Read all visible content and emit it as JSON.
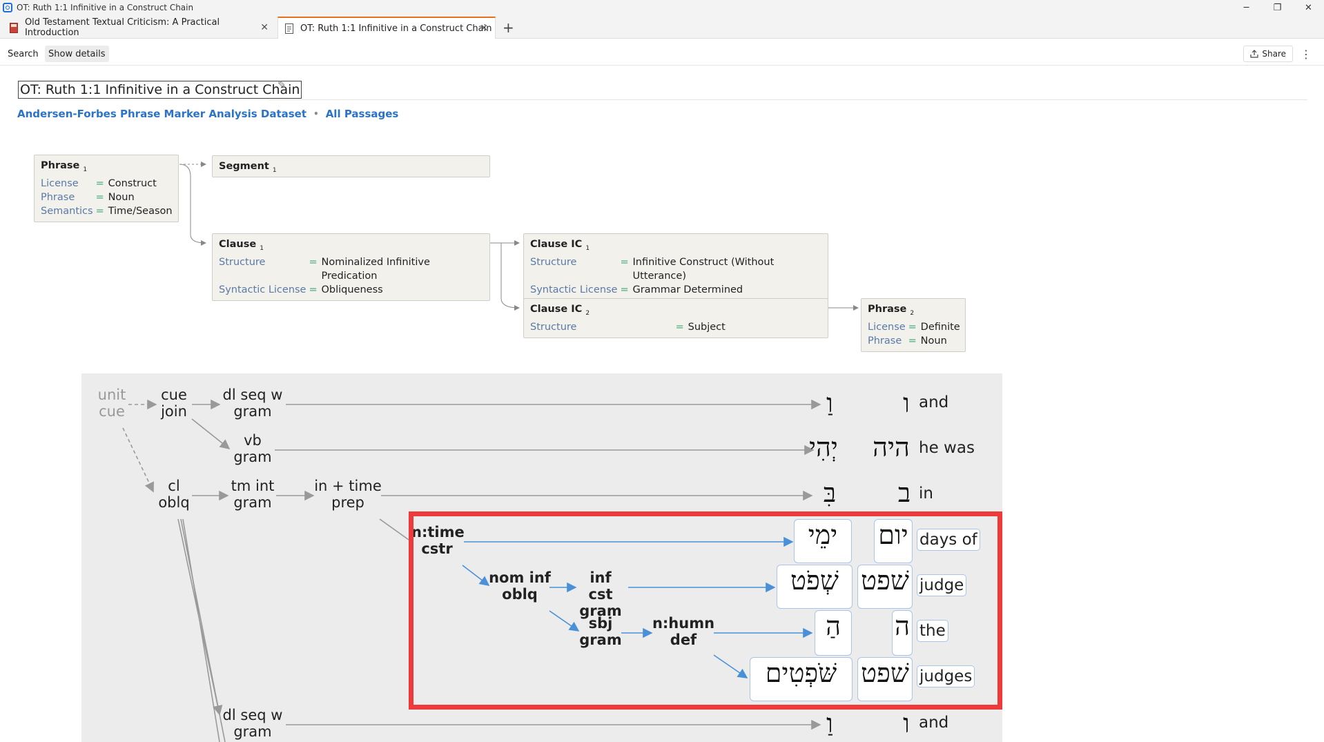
{
  "window": {
    "title": "OT: Ruth 1:1 Infinitive in a Construct Chain",
    "controls": {
      "minimize": "─",
      "restore": "❐",
      "close": "✕"
    }
  },
  "tabs": [
    {
      "label": "Old Testament Textual Criticism: A Practical Introduction",
      "close": "✕"
    },
    {
      "label": "OT: Ruth 1:1 Infinitive in a Construct Chain",
      "close": "✕"
    }
  ],
  "new_tab": "+",
  "toolbar": {
    "search": "Search",
    "show_details": "Show details",
    "share": "Share",
    "more": "⋮"
  },
  "document": {
    "title": "OT: Ruth 1:1 Infinitive in a Construct Chain",
    "edit_icon": "✎",
    "link_dataset": "Andersen-Forbes Phrase Marker Analysis Dataset",
    "link_sep": "•",
    "link_passages": "All Passages"
  },
  "tree": {
    "phrase1": {
      "head": "Phrase",
      "sub": "1",
      "rows": [
        [
          "License",
          "=",
          "Construct"
        ],
        [
          "Phrase",
          "=",
          "Noun"
        ],
        [
          "Semantics",
          "=",
          "Time/Season"
        ]
      ]
    },
    "segment1": {
      "head": "Segment",
      "sub": "1"
    },
    "clause1": {
      "head": "Clause",
      "sub": "1",
      "rows": [
        [
          "Structure",
          "=",
          "Nominalized Infinitive Predication"
        ],
        [
          "Syntactic License",
          "=",
          "Obliqueness"
        ]
      ]
    },
    "clauseic1": {
      "head": "Clause IC",
      "sub": "1",
      "rows": [
        [
          "Structure",
          "=",
          "Infinitive Construct (Without Utterance)"
        ],
        [
          "Syntactic License",
          "=",
          "Grammar Determined"
        ]
      ]
    },
    "clauseic2": {
      "head": "Clause IC",
      "sub": "2",
      "rows": [
        [
          "Structure",
          "=",
          "Subject"
        ]
      ]
    },
    "phrase2": {
      "head": "Phrase",
      "sub": "2",
      "rows": [
        [
          "License",
          "=",
          "Definite"
        ],
        [
          "Phrase",
          "=",
          "Noun"
        ]
      ]
    }
  },
  "diagram": {
    "unit": "unit",
    "cue": "cue",
    "cue_join": [
      "cue",
      "join"
    ],
    "dl_seq_w": [
      "dl seq w",
      "gram"
    ],
    "vb_gram": [
      "vb",
      "gram"
    ],
    "cl_oblq": [
      "cl",
      "oblq"
    ],
    "tm_int": [
      "tm int",
      "gram"
    ],
    "in_time": [
      "in + time",
      "prep"
    ],
    "n_time": [
      "n:time",
      "cstr"
    ],
    "nom_inf": [
      "nom inf",
      "oblq"
    ],
    "inf_cst": [
      "inf cst",
      "gram"
    ],
    "sbj_gram": [
      "sbj",
      "gram"
    ],
    "n_humn": [
      "n:humn",
      "def"
    ],
    "dl_seq_w2": [
      "dl seq w",
      "gram"
    ],
    "rows": [
      {
        "surface": "וַ",
        "lemma": "ו",
        "gloss": "and"
      },
      {
        "surface": "יְהִי",
        "lemma": "היה",
        "gloss": "he was"
      },
      {
        "surface": "בִּ",
        "lemma": "ב",
        "gloss": "in"
      },
      {
        "surface": "ימֵי",
        "lemma": "יום",
        "gloss": "days of"
      },
      {
        "surface": "שְׁפֹט",
        "lemma": "שׁפט",
        "gloss": "judge"
      },
      {
        "surface": "הַ",
        "lemma": "ה",
        "gloss": "the"
      },
      {
        "surface": "שֹּׁפְטִים",
        "lemma": "שׁפט",
        "gloss": "judges"
      },
      {
        "surface": "וַ",
        "lemma": "ו",
        "gloss": "and"
      }
    ]
  },
  "colors": {
    "accent_tab": "#e8701a",
    "link": "#2a73c9",
    "highlight": "#ee3a3a",
    "blue_arrow": "#4a90d9"
  }
}
